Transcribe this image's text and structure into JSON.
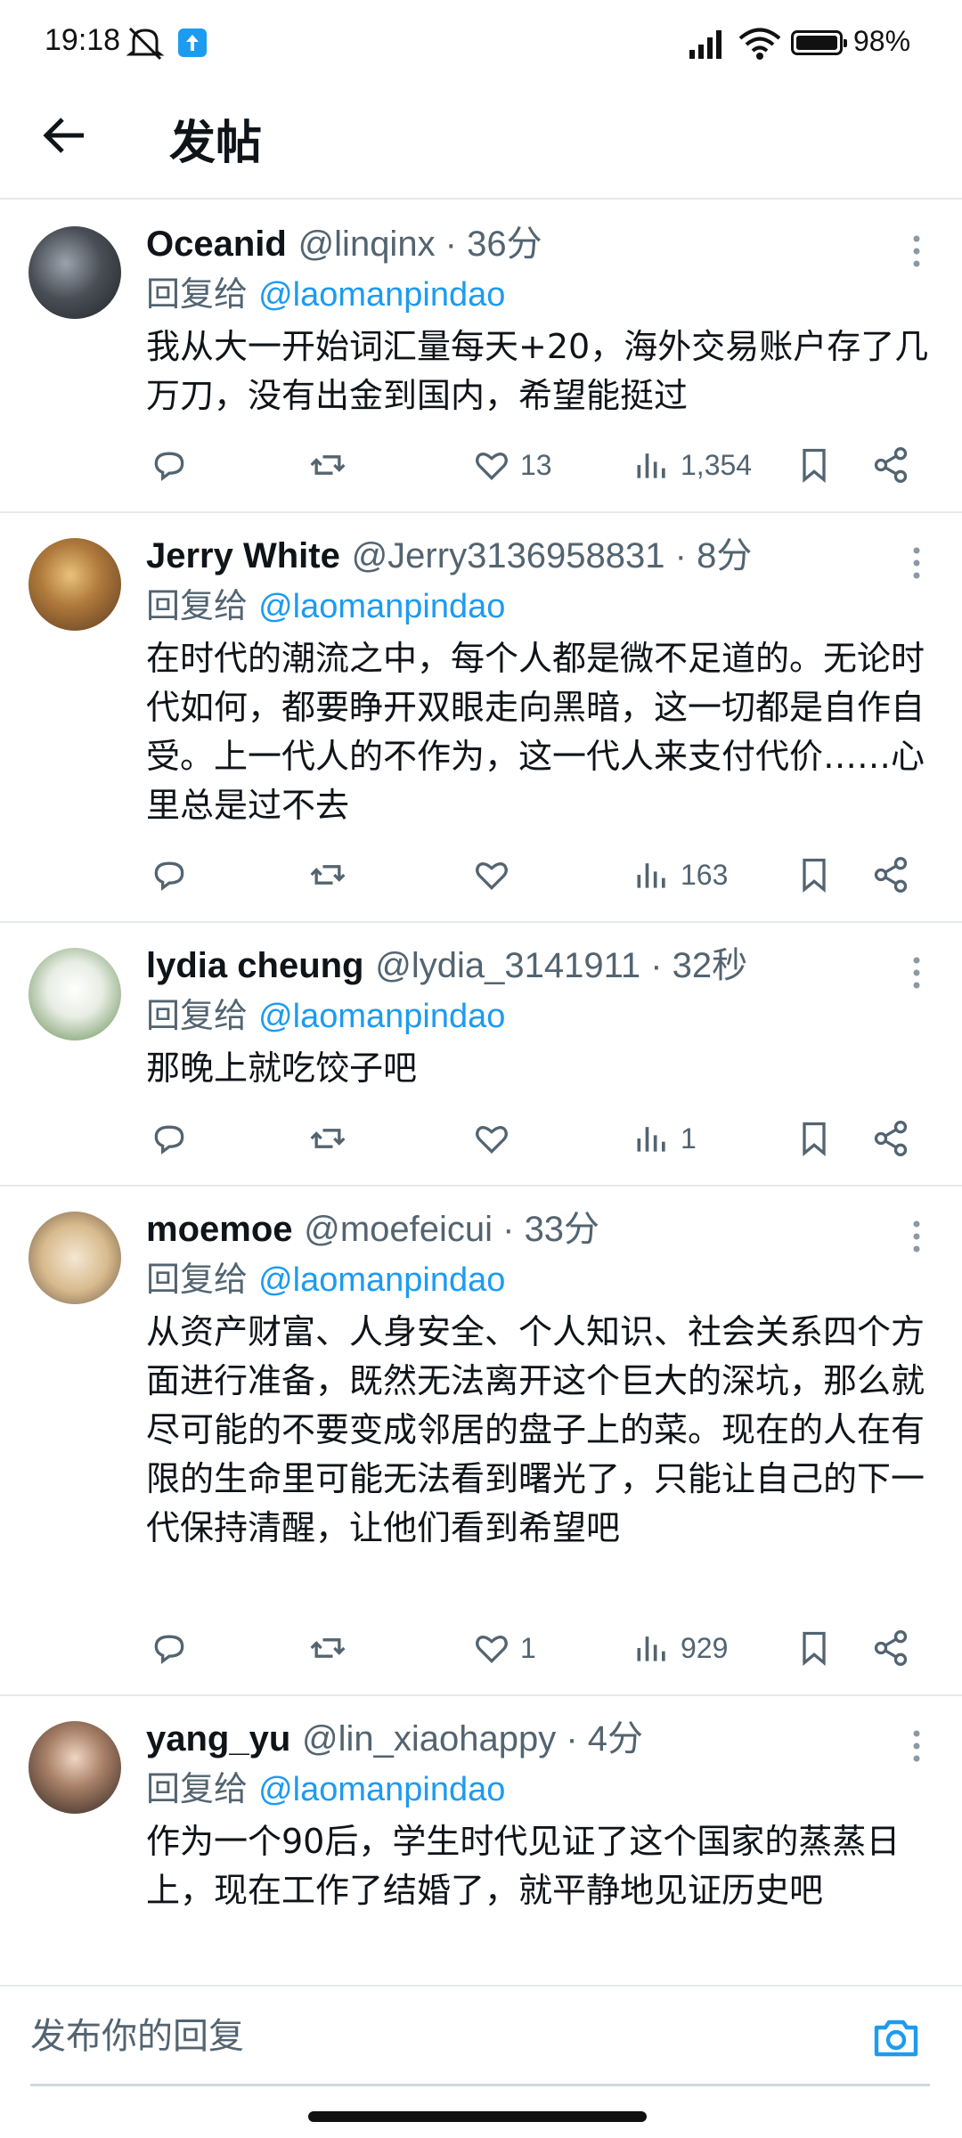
{
  "status": {
    "time": "19:18",
    "battery": "98%"
  },
  "header": {
    "title": "发帖"
  },
  "replies": [
    {
      "name": "Oceanid",
      "handle": "@linqinx · 36分",
      "replying_prefix": "回复给 ",
      "mention": "@laomanpindao",
      "text": "我从大一开始词汇量每天+20，海外交易账户存了几万刀，没有出金到国内，希望能挺过",
      "likes": "13",
      "views": "1,354"
    },
    {
      "name": "Jerry White",
      "handle": "@Jerry3136958831 · 8分",
      "replying_prefix": "回复给 ",
      "mention": "@laomanpindao",
      "text": "在时代的潮流之中，每个人都是微不足道的。无论时代如何，都要睁开双眼走向黑暗，这一切都是自作自受。上一代人的不作为，这一代人来支付代价……心里总是过不去",
      "likes": "",
      "views": "163"
    },
    {
      "name": "lydia cheung",
      "handle": "@lydia_3141911 · 32秒",
      "replying_prefix": "回复给 ",
      "mention": "@laomanpindao",
      "text": "那晚上就吃饺子吧",
      "likes": "",
      "views": "1"
    },
    {
      "name": "moemoe",
      "handle": "@moefeicui · 33分",
      "replying_prefix": "回复给 ",
      "mention": "@laomanpindao",
      "text": "从资产财富、人身安全、个人知识、社会关系四个方面进行准备，既然无法离开这个巨大的深坑，那么就尽可能的不要变成邻居的盘子上的菜。现在的人在有限的生命里可能无法看到曙光了，只能让自己的下一代保持清醒，让他们看到希望吧",
      "likes": "1",
      "views": "929"
    },
    {
      "name": "yang_yu",
      "handle": "@lin_xiaohappy · 4分",
      "replying_prefix": "回复给 ",
      "mention": "@laomanpindao",
      "text": "作为一个90后，学生时代见证了这个国家的蒸蒸日上，现在工作了结婚了，就平静地见证历史吧"
    }
  ],
  "compose": {
    "placeholder": "发布你的回复"
  },
  "icons": [
    "back-arrow-icon",
    "more-icon",
    "reply-icon",
    "retweet-icon",
    "like-icon",
    "views-icon",
    "bookmark-icon",
    "share-icon",
    "camera-icon"
  ],
  "colors": {
    "accent": "#1d9bf0",
    "secondary_text": "#536471",
    "divider": "#e6e9ec"
  }
}
